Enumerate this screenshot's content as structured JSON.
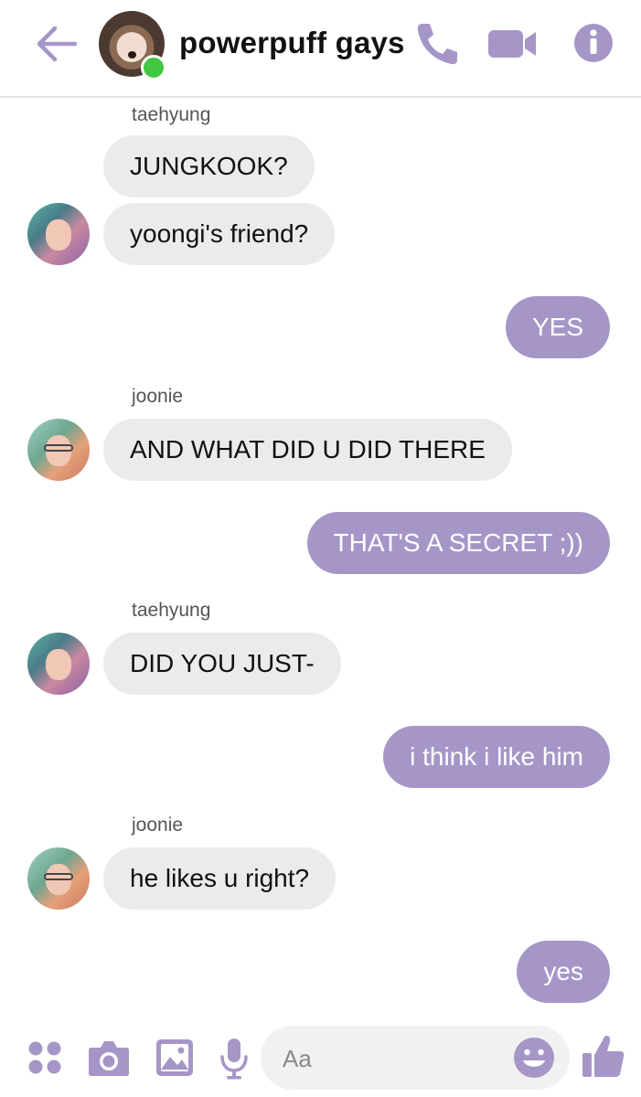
{
  "header": {
    "title": "powerpuff gays",
    "back_icon": "arrow-left-icon",
    "call_icon": "phone-icon",
    "video_icon": "video-camera-icon",
    "info_icon": "info-icon",
    "accent": "#a696c8"
  },
  "messages": [
    {
      "sender": "taehyung",
      "text": "JUNGKOOK?",
      "direction": "in"
    },
    {
      "text": "yoongi's friend?",
      "direction": "in"
    },
    {
      "text": "YES",
      "direction": "out"
    },
    {
      "sender": "joonie",
      "text": "AND WHAT DID U DID THERE",
      "direction": "in"
    },
    {
      "text": "THAT'S A SECRET ;))",
      "direction": "out"
    },
    {
      "sender": "taehyung",
      "text": "DID YOU JUST-",
      "direction": "in"
    },
    {
      "text": "i think i like him",
      "direction": "out"
    },
    {
      "sender": "joonie",
      "text": "he likes u right?",
      "direction": "in"
    },
    {
      "text": "yes",
      "direction": "out"
    }
  ],
  "composer": {
    "placeholder": "Aa",
    "icons": [
      "apps-grid-icon",
      "camera-icon",
      "image-icon",
      "microphone-icon",
      "emoji-icon",
      "thumbs-up-icon"
    ]
  },
  "colors": {
    "outgoing_bubble": "#a696c8",
    "incoming_bubble": "#ebebeb",
    "online": "#42c742"
  }
}
